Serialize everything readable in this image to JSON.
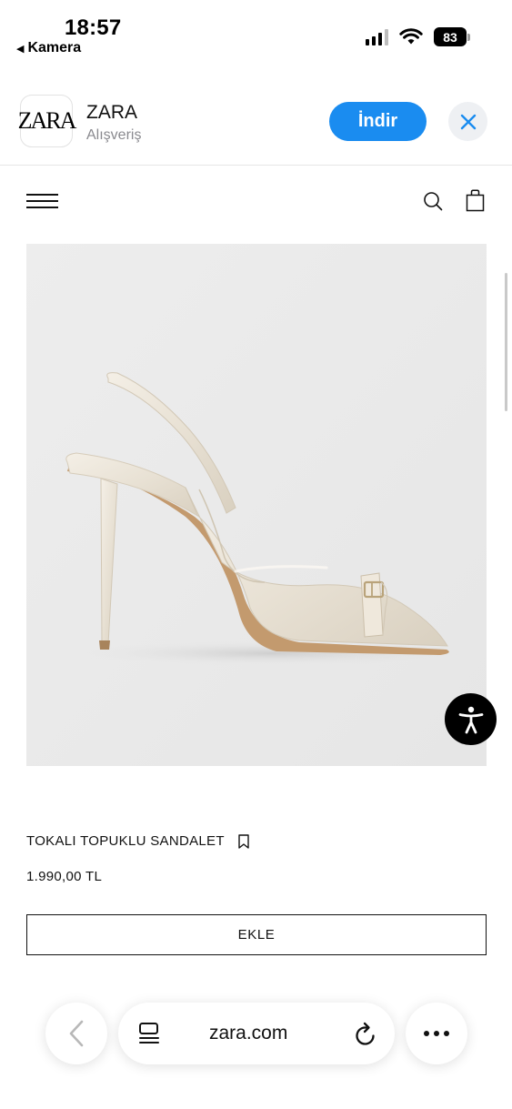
{
  "status_bar": {
    "time": "18:57",
    "back_app": "Kamera",
    "battery": "83"
  },
  "app_banner": {
    "icon_text": "ZARA",
    "name": "ZARA",
    "category": "Alışveriş",
    "install_label": "İndir",
    "accent_color": "#1a8cf0"
  },
  "product": {
    "name": "TOKALI TOPUKLU SANDALET",
    "price": "1.990,00 TL",
    "add_label": "EKLE",
    "image_icon": "slingback-heel-sandal-image"
  },
  "browser": {
    "url": "zara.com",
    "icons": [
      "chevron-left-icon",
      "reader-icon",
      "reload-icon",
      "more-icon"
    ]
  }
}
